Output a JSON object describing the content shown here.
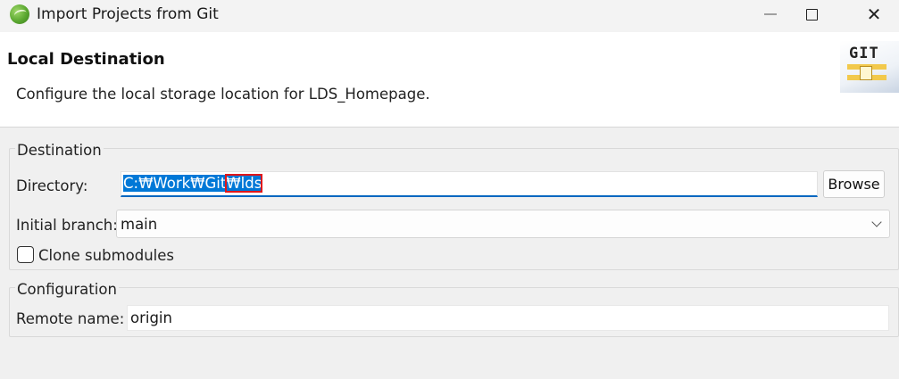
{
  "window": {
    "title": "Import Projects from Git",
    "icon": "eclipse-icon",
    "close_glyph": "✕"
  },
  "header": {
    "title": "Local Destination",
    "description": "Configure the local storage location for LDS_Homepage.",
    "logo_text": "GIT"
  },
  "destination": {
    "group_label": "Destination",
    "directory_label": "Directory:",
    "directory_value_prefix": "C:₩Work₩Git",
    "directory_value_suffix": "₩lds",
    "browse_label": "Browse",
    "branch_label": "Initial branch:",
    "branch_value": "main",
    "clone_submodules_label": "Clone submodules",
    "clone_submodules_checked": false
  },
  "configuration": {
    "group_label": "Configuration",
    "remote_label": "Remote name:",
    "remote_value": "origin"
  },
  "colors": {
    "selection": "#0078d7",
    "highlight_box": "#e0161a",
    "focus_underline": "#0067c0"
  }
}
